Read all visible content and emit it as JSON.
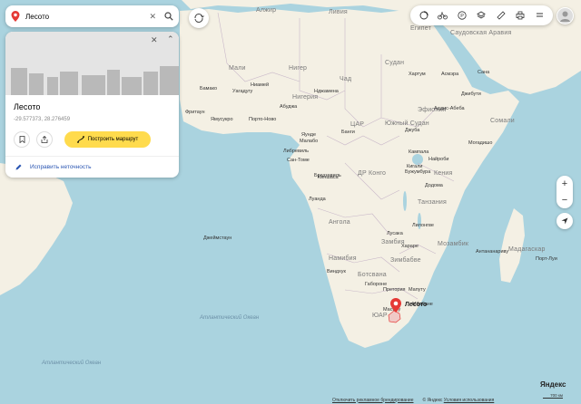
{
  "search": {
    "query": "Лесото"
  },
  "card": {
    "title": "Лесото",
    "coords": "-29.577373, 28.276459",
    "route_label": "Построить маршрут",
    "fix_label": "Исправить неточность"
  },
  "map": {
    "countries": [
      "Алжир",
      "Ливия",
      "Египет",
      "Мали",
      "Нигер",
      "Чад",
      "Судан",
      "Саудовская Аравия",
      "Эфиопия",
      "Южный Судан",
      "ЦАР",
      "Кения",
      "ДР Конго",
      "Танзания",
      "Ангола",
      "Замбия",
      "Ботсвана",
      "Намибия",
      "ЮАР",
      "Мадагаскар",
      "Нигерия",
      "Сомали",
      "Мозамбик",
      "Зимбабве"
    ],
    "cities": [
      "Бамако",
      "Ниамей",
      "Уагадугу",
      "Нджамена",
      "Хартум",
      "Асмэра",
      "Сана",
      "Аддис-Абеба",
      "Джибути",
      "Абуджа",
      "Фритаун",
      "Ямусукро",
      "Порто-Ново",
      "Малабо",
      "Банги",
      "Джуба",
      "Могадишо",
      "Яунде",
      "Либревиль",
      "Сан-Томе",
      "Кампала",
      "Найроби",
      "Кигали",
      "Бужумбура",
      "Браззавиль",
      "Киншаса",
      "Додома",
      "Луанда",
      "Лилонгве",
      "Лусака",
      "Хараре",
      "Виндхук",
      "Габороне",
      "Претория",
      "Мапуту",
      "Масеру",
      "Антананариву",
      "Порт-Луи",
      "Джеймстаун",
      "Мбабане"
    ],
    "seas": [
      "Атлантический Океан",
      "Атлантический Океан"
    ],
    "selected_label": "Лесото"
  },
  "zoom": {
    "plus": "+",
    "minus": "−"
  },
  "footer": {
    "ad": "Отключить рекламное брендирование",
    "copyright": "© Яндекс",
    "terms": "Условия использования"
  },
  "brand": "Яндекс",
  "scale": "700 км",
  "colors": {
    "water": "#aad3df",
    "land": "#f4f0e4",
    "accent": "#ffdb4d",
    "pin": "#e53935",
    "link": "#2a55b2"
  },
  "icons": [
    "location-pin-icon",
    "close-icon",
    "search-icon",
    "chevron-up-icon",
    "bookmark-icon",
    "share-icon",
    "route-icon",
    "pencil-icon",
    "traffic-icon",
    "bike-icon",
    "parking-icon",
    "layers-icon",
    "ruler-icon",
    "print-icon",
    "menu-icon",
    "avatar-icon",
    "compass-icon",
    "geolocation-icon"
  ]
}
